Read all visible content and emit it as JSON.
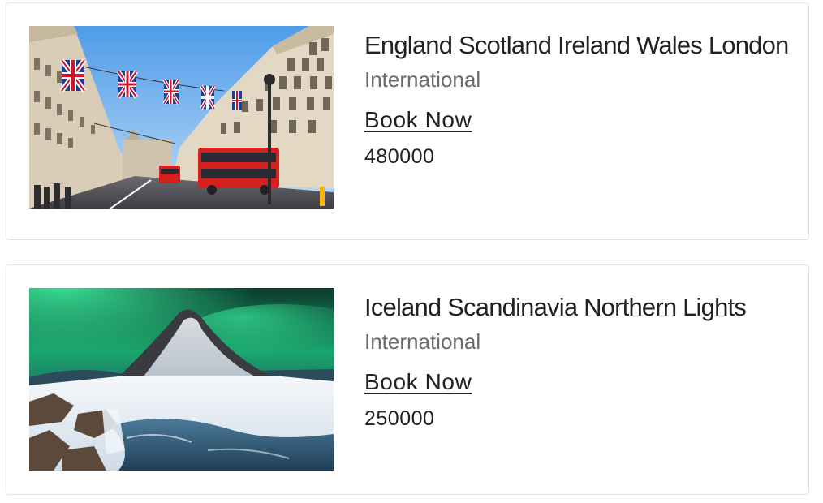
{
  "tours": [
    {
      "title": "England Scotland Ireland Wales London",
      "category": "International",
      "book_label": "Book Now",
      "price": "480000",
      "image": "london-regent-street-photo"
    },
    {
      "title": "Iceland Scandinavia Northern Lights",
      "category": "International",
      "book_label": "Book Now",
      "price": "250000",
      "image": "iceland-aurora-mountain-photo"
    }
  ]
}
